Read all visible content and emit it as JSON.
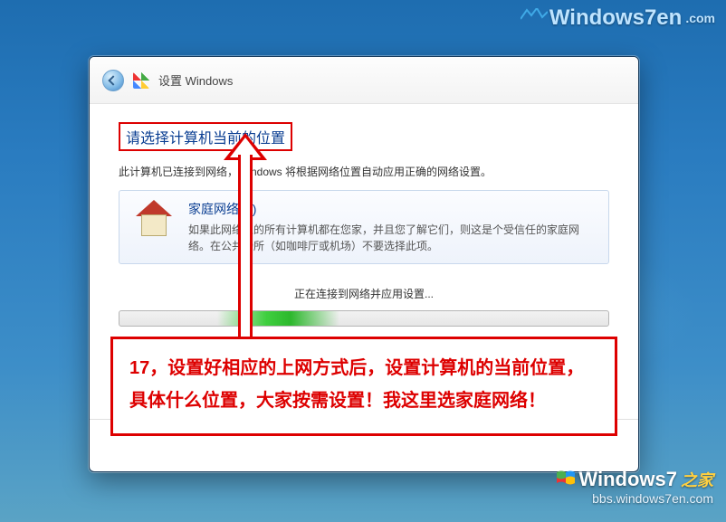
{
  "watermark_top": {
    "brand": "Windows7en",
    "suffix": ".com"
  },
  "watermark_bottom": {
    "line1_brand": "Windows7",
    "line1_zhijia": "之家",
    "line2": "bbs.windows7en.com"
  },
  "dialog": {
    "title": "设置 Windows",
    "headline": "请选择计算机当前的位置",
    "subtext": "此计算机已连接到网络，Windows 将根据网络位置自动应用正确的网络设置。",
    "option_home": {
      "title": "家庭网络(H)",
      "desc": "如果此网络上的所有计算机都在您家，并且您了解它们，则这是个受信任的家庭网络。在公共场所（如咖啡厅或机场）不要选择此项。"
    },
    "progress_label": "正在连接到网络并应用设置..."
  },
  "annotation": {
    "caption": "17，设置好相应的上网方式后，设置计算机的当前位置，具体什么位置，大家按需设置！我这里选家庭网络！"
  }
}
